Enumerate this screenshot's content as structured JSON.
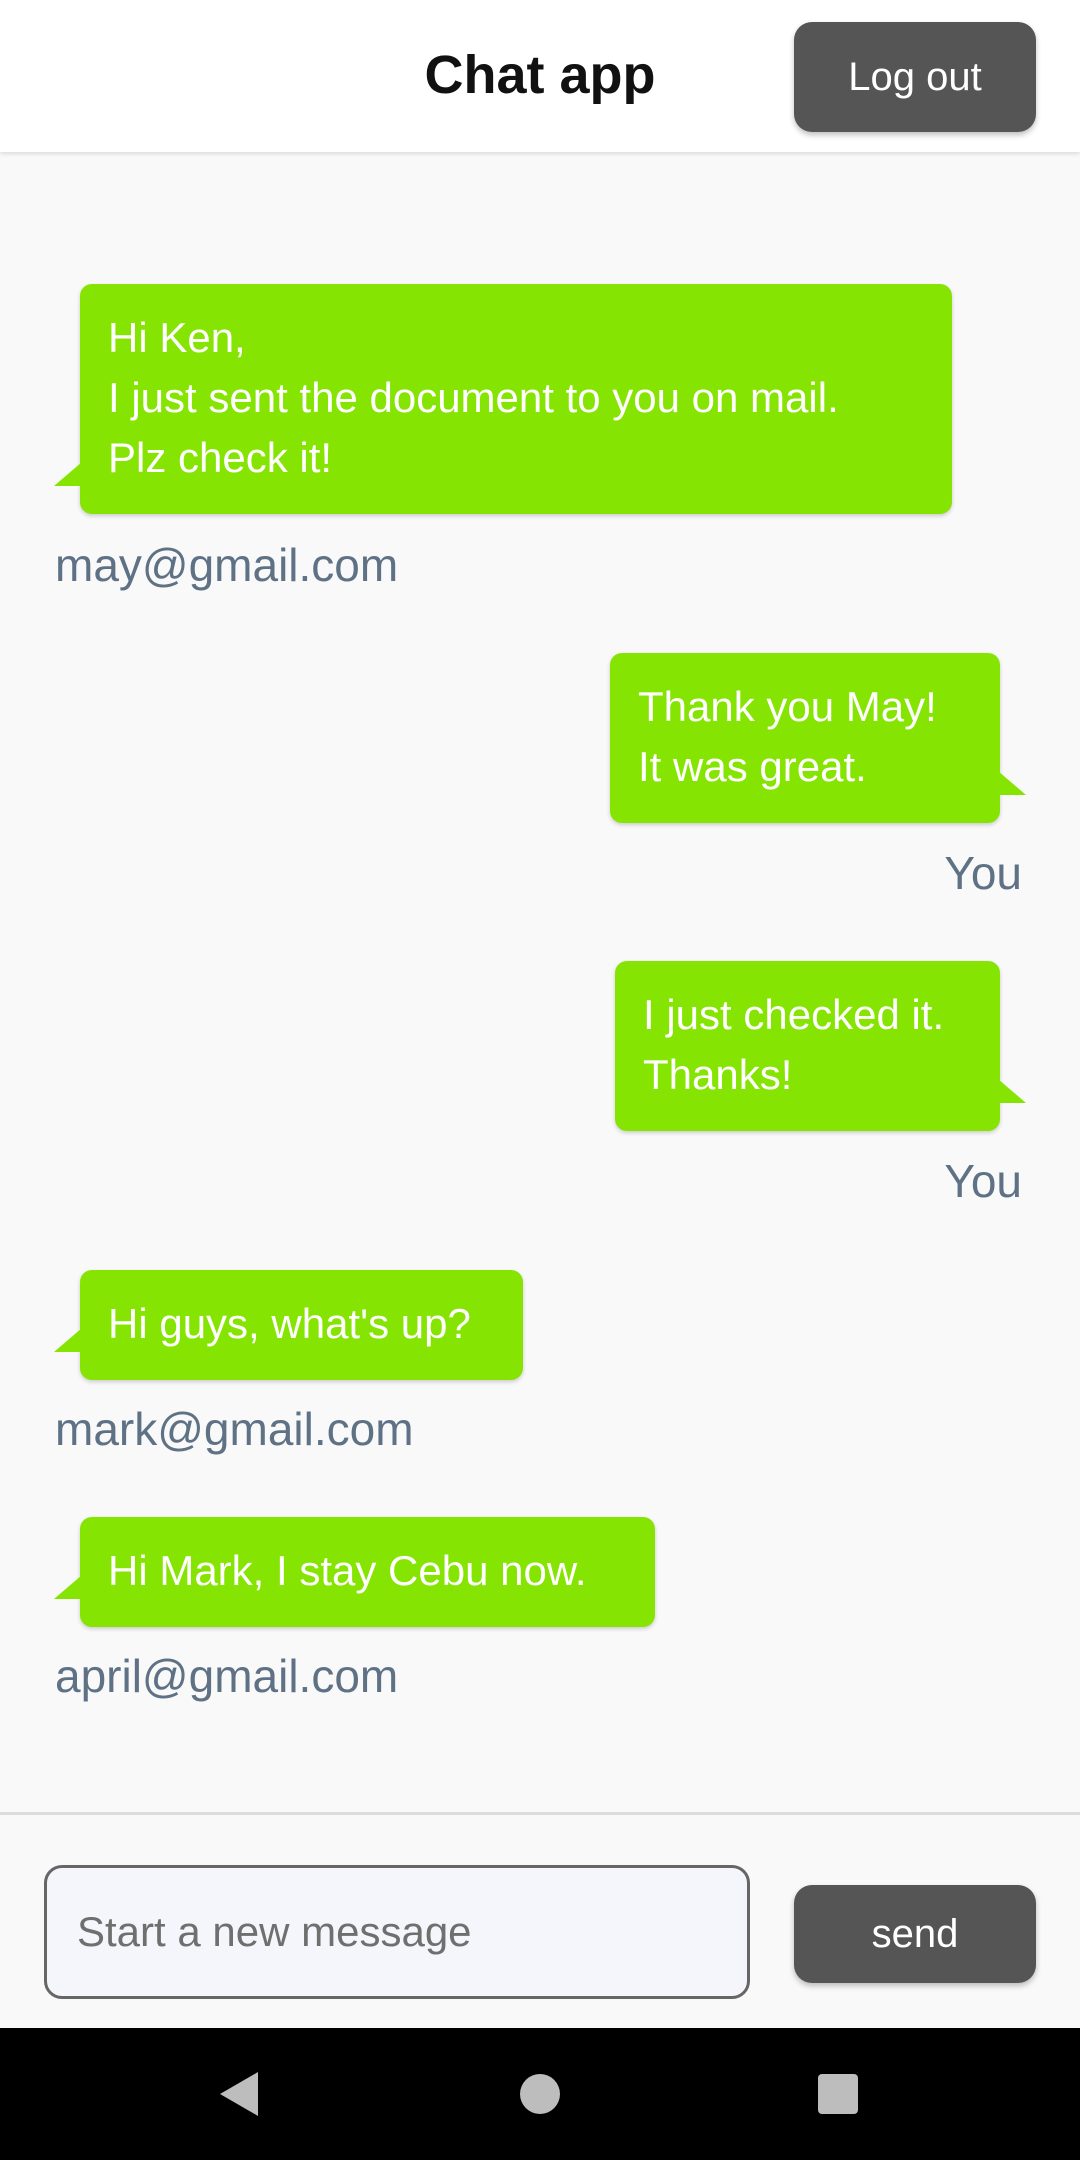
{
  "header": {
    "title": "Chat app",
    "logout_label": "Log out"
  },
  "messages": [
    {
      "text": "Hi Ken,\nI just sent the document to you on mail.\nPlz check it!",
      "sender": "may@gmail.com",
      "side": "left"
    },
    {
      "text": "Thank you May!\nIt was great.",
      "sender": "You",
      "side": "right"
    },
    {
      "text": "I just checked it.\nThanks!",
      "sender": "You",
      "side": "right"
    },
    {
      "text": "Hi guys, what's up?",
      "sender": "mark@gmail.com",
      "side": "left"
    },
    {
      "text": "Hi Mark, I stay Cebu now.",
      "sender": "april@gmail.com",
      "side": "left"
    }
  ],
  "composer": {
    "placeholder": "Start a new message",
    "value": "",
    "send_label": "send"
  },
  "nav": {
    "icons": [
      "back-icon",
      "home-icon",
      "recents-icon"
    ]
  },
  "colors": {
    "bubble": "#86e403",
    "button": "#555555",
    "sender_text": "#5f7285"
  }
}
